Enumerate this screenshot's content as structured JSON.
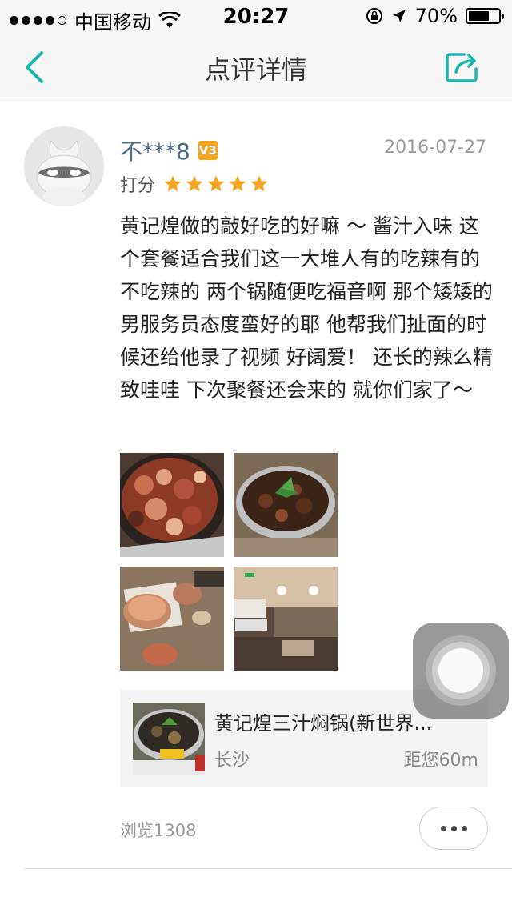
{
  "status_bar": {
    "carrier": "中国移动",
    "time": "20:27",
    "battery": "70%",
    "battery_level": 0.7
  },
  "nav": {
    "title": "点评详情",
    "back_icon": "chevron-left-icon",
    "share_icon": "share-icon"
  },
  "review": {
    "username": "不***8",
    "vip_level": "V3",
    "date": "2016-07-27",
    "score_label": "打分",
    "rating": 5,
    "rating_max": 5,
    "content": "黄记煌做的敲好吃的好嘛 ～ 酱汁入味 这个套餐适合我们这一大堆人有的吃辣有的不吃辣的 两个锅随便吃福音啊 那个矮矮的男服务员态度蛮好的耶 他帮我们扯面的时候还给他录了视频 好阔爱！ 还长的辣么精致哇哇 下次聚餐还会来的 就你们家了～",
    "photos": [
      "food-photo-1",
      "food-photo-2",
      "food-photo-3",
      "restaurant-photo-4"
    ]
  },
  "shop": {
    "name": "黄记煌三汁焖锅(新世界...",
    "city": "长沙",
    "distance": "距您60m"
  },
  "footer": {
    "views": "浏览1308"
  },
  "colors": {
    "accent": "#1bb5b0",
    "star": "#f5a623",
    "username": "#4e6b8c"
  }
}
